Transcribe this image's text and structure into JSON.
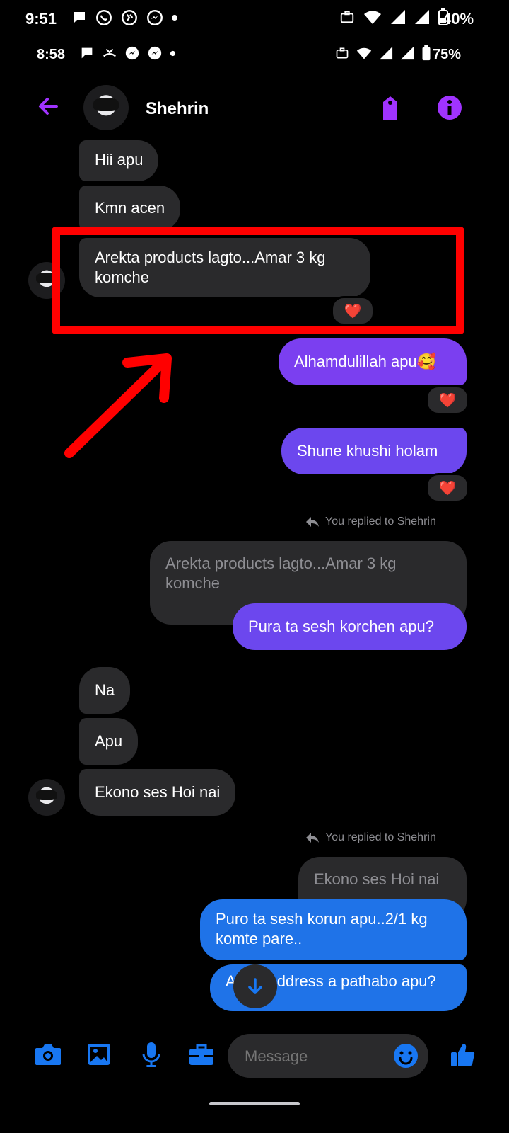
{
  "status_bar_1": {
    "time": "9:51",
    "battery": "40%"
  },
  "status_bar_2": {
    "time": "8:58",
    "battery": "75%"
  },
  "header": {
    "contact_name": "Shehrin"
  },
  "messages": {
    "m1": "Hii apu",
    "m2": "Kmn acen",
    "m3": "Arekta products lagto...Amar 3 kg komche",
    "m4": "Alhamdulillah apu🥰",
    "m5": "Shune khushi holam",
    "reply_meta_1": "You replied to Shehrin",
    "quote_1": "Arekta products lagto...Amar 3 kg komche",
    "m6": "Pura ta sesh korchen apu?",
    "m7": "Na",
    "m8": "Apu",
    "m9": "Ekono ses Hoi nai",
    "reply_meta_2": "You replied to Shehrin",
    "quote_2": "Ekono ses Hoi nai",
    "m10": "Puro ta sesh korun apu..2/1 kg komte pare..",
    "m11_prefix": "A",
    "m11_suffix": "ddress a pathabo apu?",
    "reaction": "❤️"
  },
  "composer": {
    "placeholder": "Message"
  },
  "colors": {
    "accent_purple": "#a033ff",
    "bubble_purple": "#7b3ff0",
    "bubble_blue": "#1f73e8",
    "annotation_red": "#ff0000",
    "icon_blue": "#1877f2"
  }
}
